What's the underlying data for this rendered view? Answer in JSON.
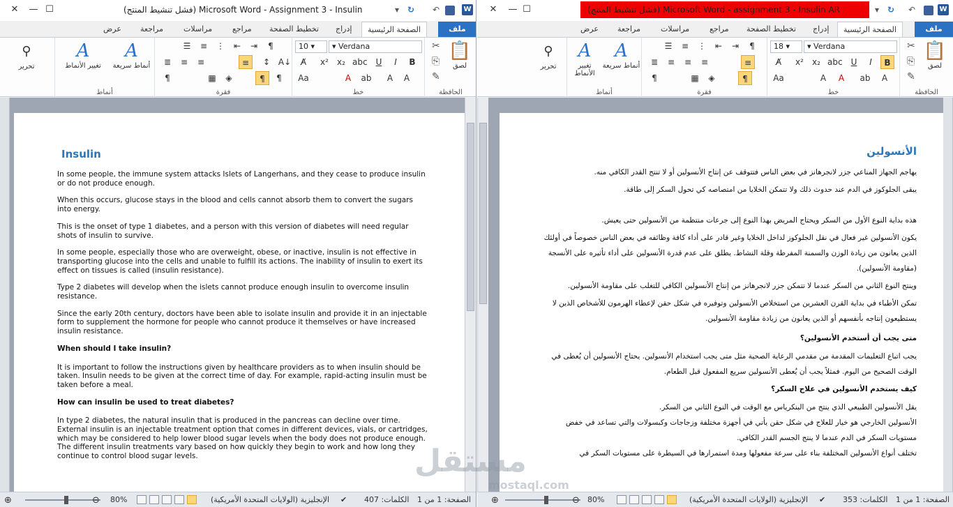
{
  "left": {
    "title": "(فشل تنشيط المنتج) Microsoft Word  -  Assignment 3 - Insulin",
    "tabs": [
      "ملف",
      "الصفحة الرئيسية",
      "إدراج",
      "تخطيط الصفحة",
      "مراجع",
      "مراسلات",
      "مراجعة",
      "عرض"
    ],
    "font_size": "10",
    "font_name": "Verdana",
    "groups": {
      "clipboard": "الحافظة",
      "font": "خط",
      "paragraph": "فقرة",
      "styles": "أنماط",
      "editing": ""
    },
    "buttons": {
      "paste": "لصق",
      "quick_styles": "أنماط سريعة",
      "change_styles": "تغيير الأنماط",
      "editing": "تحرير"
    },
    "doc": {
      "title": "Insulin",
      "paragraphs": [
        "In some people, the immune system attacks Islets of Langerhans, and they cease to produce insulin or do not produce enough.",
        "When this occurs, glucose stays in the blood and cells cannot absorb them to convert the sugars into energy.",
        "This is the onset of type 1 diabetes, and a person with this version of diabetes will need regular shots of insulin to survive.",
        "In some people, especially those who are overweight, obese, or inactive, insulin is not effective in transporting glucose into the cells and unable to fulfill its actions. The inability of insulin to exert its effect on tissues is called (insulin resistance).",
        "Type 2 diabetes will develop when the islets cannot produce enough insulin to overcome insulin resistance.",
        "Since the early 20th century, doctors have been able to isolate insulin and provide it in an injectable form to supplement the hormone for people who cannot produce it themselves or have increased insulin resistance."
      ],
      "heading1": "When should I take insulin?",
      "p7": "It is important to follow the instructions given by healthcare providers as to when insulin should be taken. Insulin needs to be given at the correct time of day. For example, rapid-acting insulin must be taken before a meal.",
      "heading2": "How can insulin be used to treat diabetes?",
      "p8": "In type 2 diabetes, the natural insulin that is produced in the pancreas can decline over time. External insulin is an injectable treatment option that comes in different devices, vials, or cartridges, which may be considered to help lower blood sugar levels when the body does not produce enough.",
      "p9": "The different insulin treatments vary based on how quickly they begin to work and how long they continue to control blood sugar levels."
    },
    "status": {
      "page": "الصفحة: 1 من 1",
      "words": "الكلمات: 407",
      "language": "الإنجليزية (الولايات المتحدة الأمريكية)",
      "zoom": "80%",
      "zoom_level": 0.8
    }
  },
  "right": {
    "title": "(فشل تنشيط المنتج) Microsoft Word  -  assignment 3 - Insulin AR",
    "tabs": [
      "ملف",
      "الصفحة الرئيسية",
      "إدراج",
      "تخطيط الصفحة",
      "مراجع",
      "مراسلات",
      "مراجعة",
      "عرض"
    ],
    "font_size": "18",
    "font_name": "Verdana",
    "groups": {
      "clipboard": "الحافظة",
      "font": "خط",
      "paragraph": "فقرة",
      "styles": "أنماط"
    },
    "buttons": {
      "paste": "لصق",
      "quick_styles": "أنماط سريعة",
      "change_styles": "تغيير الأنماط",
      "editing": "تحرير"
    },
    "doc": {
      "title": "الأنسولين",
      "p1": "يهاجم الجهاز المناعي جزر لانجرهانز في بعض الناس  فتتوقف عن إنتاج الأنسولين أو لا تنتج القدر الكافي منه.",
      "p2": "يبقى الجلوكوز في الدم عند حدوث ذلك ولا تتمكن الخلايا من امتصاصه كي تحول السكر إلى طاقة.",
      "p3": "هذه بداية النوع الأول من السكر ويحتاج المريض بهذا النوع  إلى جرعات منتظمة من الأنسولين حتى يعيش.",
      "p4": "يكون الأنسولين غير فعال في نقل الجلوكوز لداخل الخلايا وغير قادر  على أداء كافة وظائفه في بعض الناس خصوصاً في أولئك الذين يعانون من زيادة الوزن والسمنة المفرطة وقلة النشاط. يطلق على عدم قدرة الأنسولين على أداء تأثيره على الأنسجة (مقاومة الأنسولين).",
      "p5": "وينتج النوع الثاني من السكر  عندما لا تتمكن جزر  لانجرهانز من إنتاج الأنسولين الكافي للتغلب على مقاومة الأنسولين.",
      "p6": "تمكن الأطباء في بداية القرن العشرين من استخلاص الأنسولين وتوفيره في شكل حقن لإعطاء الهرمون للأشخاص الذين لا يستطيعون إنتاجه بأنفسهم أو الذين يعانون من زيادة مقاومة الأنسولين.",
      "heading1": "متى يجب أن أستخدم الأنسولين؟",
      "p7": "يجب اتباع التعليمات المقدمة من مقدمي الرعاية الصحية مثل متى يجب استخدام الأنسولين. يحتاج الأنسولين أن يُعطى في الوقت الصحيح من اليوم. فمثلاً يجب أن يُعطى الأنسولين سريع المفعول قبل الطعام.",
      "heading2": "كيف يستخدم الأنسولين في علاج السكر؟",
      "p8": "يقل الأنسولين الطبيعي الذي ينتج من البنكرياس مع الوقت في النوع الثاني من السكر.",
      "p9": "الأنسولين الخارجي هو خيار للعلاج في شكل حقن يأتي في أجهزة مختلفة  وزجاجات وكبسولات والتي تساعد في خفض مستويات السكر في الدم عندما لا ينتج الجسم القدر الكافي.",
      "p10": "تختلف أنواع الأنسولين المختلفة بناء على سرعة مفعولها ومدة استمرارها في السيطرة على مستويات السكر في"
    },
    "status": {
      "page": "الصفحة: 1 من 1",
      "words": "الكلمات: 353",
      "language": "الإنجليزية (الولايات المتحدة الأمريكية)",
      "zoom": "80%",
      "zoom_level": 0.8
    }
  },
  "watermark": {
    "text": "مستقل",
    "sub": "mostaql.com"
  },
  "colors": {
    "accent": "#2b72c4",
    "title_red": "#ee0000",
    "heading_blue": "#2d76b7",
    "highlight": "#fbd77a"
  }
}
